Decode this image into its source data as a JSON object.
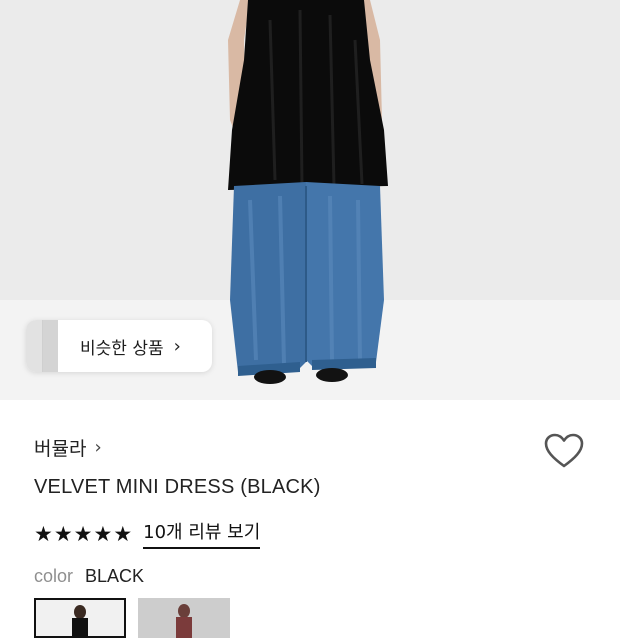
{
  "hero": {
    "similar_label": "비슷한 상품",
    "similar_chevron": "›"
  },
  "product": {
    "brand": "버뮬라",
    "brand_chevron": "›",
    "title": "VELVET MINI DRESS (BLACK)",
    "stars": [
      "★",
      "★",
      "★",
      "★",
      "★"
    ],
    "rating": 5,
    "review_link": "10개 리뷰 보기",
    "color_key": "color",
    "color_value": "BLACK"
  },
  "icons": {
    "heart": "heart-outline-icon",
    "star": "star-filled-icon"
  }
}
